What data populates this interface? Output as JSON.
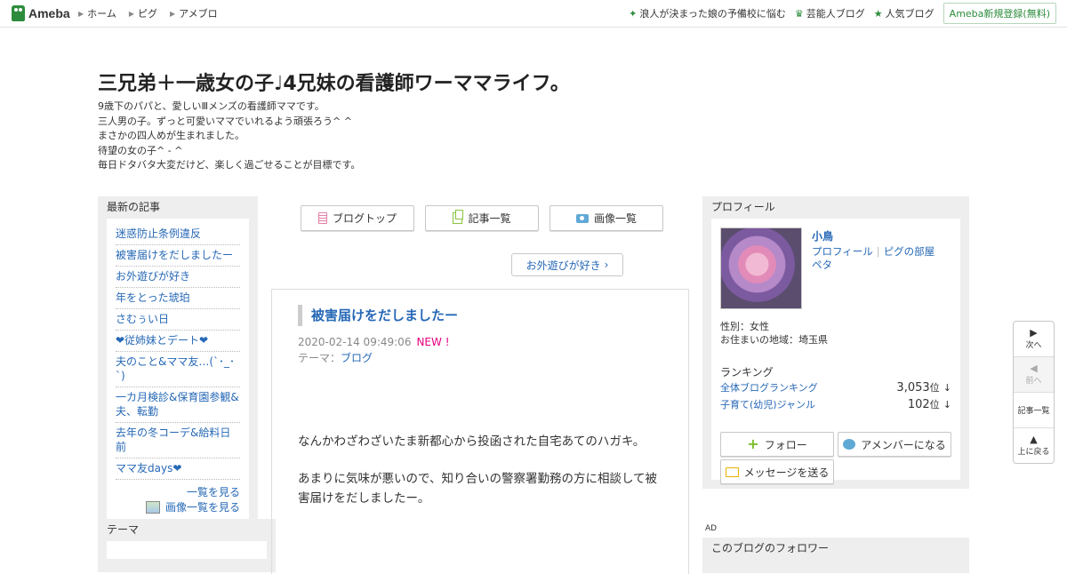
{
  "topbar": {
    "logo": "Ameba",
    "nav": [
      "ホーム",
      "ピグ",
      "アメブロ"
    ],
    "right_links": [
      {
        "icon": "sparkle-icon",
        "label": "浪人が決まった娘の予備校に悩む"
      },
      {
        "icon": "crown-icon",
        "label": "芸能人ブログ"
      },
      {
        "icon": "star-icon",
        "label": "人気ブログ"
      }
    ],
    "register_label": "Ameba新規登録(無料)"
  },
  "blog": {
    "title": "三兄弟＋一歳女の子♩4兄妹の看護師ワーママライフ。",
    "description": [
      "9歳下のパパと、愛しいⅢメンズの看護師ママです。",
      "三人男の子。ずっと可愛いママでいれるよう頑張ろう^ ^",
      "まさかの四人めが生まれました。",
      "待望の女の子^ - ^",
      "毎日ドタバタ大変だけど、楽しく過ごせることが目標です。"
    ]
  },
  "left": {
    "recent_heading": "最新の記事",
    "recent": [
      "迷惑防止条例違反",
      "被害届けをだしましたー",
      "お外遊びが好き",
      "年をとった琥珀",
      "さむぅい日",
      "❤従姉妹とデート❤",
      "夫のこと&ママ友…(`･_･`)",
      "一カ月検診&保育園参観&夫、転勤",
      "去年の冬コーデ&給料日前",
      "ママ友days❤"
    ],
    "see_all": "一覧を見る",
    "image_all": "画像一覧を見る",
    "theme_heading": "テーマ"
  },
  "center": {
    "buttons": [
      "ブログトップ",
      "記事一覧",
      "画像一覧"
    ],
    "theme_pill": "お外遊びが好き",
    "article": {
      "title": "被害届けをだしましたー",
      "date": "2020-02-14 09:49:06",
      "new_badge": "NEW !",
      "theme_label": "テーマ：",
      "theme": "ブログ",
      "paragraphs": [
        "なんかわざわざいたま新都心から投函された自宅あてのハガキ。",
        "あまりに気味が悪いので、知り合いの警察署勤務の方に相談して被害届けをだしましたー。"
      ]
    }
  },
  "right": {
    "profile_heading": "プロフィール",
    "name": "小鳥",
    "link_profile": "プロフィール",
    "link_pig": "ピグの部屋",
    "link_pet": "ペタ",
    "gender": "性別：女性",
    "area": "お住まいの地域：埼玉県",
    "ranking_heading": "ランキング",
    "rankings": [
      {
        "label": "全体ブログランキング",
        "value": "3,053",
        "unit": "位",
        "trend": "↓"
      },
      {
        "label": "子育て(幼児)ジャンル",
        "value": "102",
        "unit": "位",
        "trend": "↓"
      }
    ],
    "follow": "フォロー",
    "amember": "アメンバーになる",
    "message": "メッセージを送る",
    "ad": "AD",
    "followers_heading": "このブログのフォロワー"
  },
  "pager": {
    "next": "次へ",
    "prev": "前へ",
    "list": "記事一覧",
    "top": "上に戻る"
  }
}
